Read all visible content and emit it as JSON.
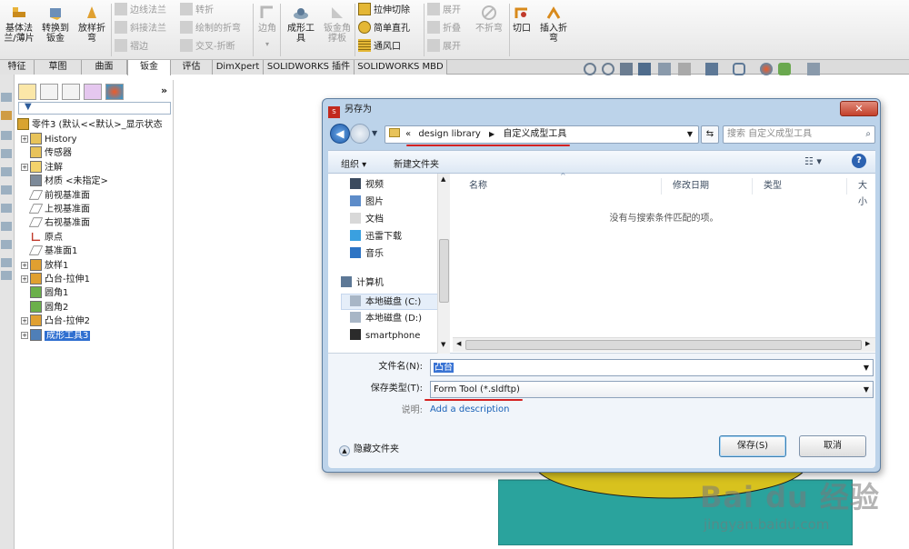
{
  "ribbon": {
    "big_buttons": [
      {
        "label": "基体法\n兰/薄片"
      },
      {
        "label": "转换到\n钣金"
      },
      {
        "label": "放样折\n弯"
      }
    ],
    "small_col1": [
      "边线法兰",
      "斜接法兰",
      "褶边"
    ],
    "small_col2": [
      "转折",
      "绘制的折弯",
      "交叉-折断"
    ],
    "corner_label": "边角",
    "forming_tool_label": "成形工\n具",
    "sheet_metal_gusset_label": "钣金角\n撑板",
    "small_col3": [
      "拉伸切除",
      "简单直孔",
      "通风口"
    ],
    "small_col4": [
      "展开",
      "折叠",
      "展开"
    ],
    "no_bend_label": "不折弯",
    "rip_label": "切口",
    "insert_bends_label": "插入折\n弯"
  },
  "tabs": [
    {
      "label": "特征",
      "active": false
    },
    {
      "label": "草图",
      "active": false
    },
    {
      "label": "曲面",
      "active": false
    },
    {
      "label": "钣金",
      "active": true
    },
    {
      "label": "评估",
      "active": false
    },
    {
      "label": "DimXpert",
      "active": false
    },
    {
      "label": "SOLIDWORKS 插件",
      "active": false
    },
    {
      "label": "SOLIDWORKS MBD",
      "active": false
    }
  ],
  "tree": {
    "root": "零件3  (默认<<默认>_显示状态",
    "items": [
      {
        "label": "History",
        "icon": "history-icon",
        "expandable": true
      },
      {
        "label": "传感器",
        "icon": "sensor-icon",
        "expandable": false
      },
      {
        "label": "注解",
        "icon": "annotation-icon",
        "expandable": true
      },
      {
        "label": "材质 <未指定>",
        "icon": "material-icon",
        "expandable": false
      },
      {
        "label": "前视基准面",
        "icon": "plane-icon",
        "expandable": false
      },
      {
        "label": "上视基准面",
        "icon": "plane-icon",
        "expandable": false
      },
      {
        "label": "右视基准面",
        "icon": "plane-icon",
        "expandable": false
      },
      {
        "label": "原点",
        "icon": "origin-icon",
        "expandable": false
      },
      {
        "label": "基准面1",
        "icon": "plane-icon",
        "expandable": false
      },
      {
        "label": "放样1",
        "icon": "loft-icon",
        "expandable": true
      },
      {
        "label": "凸台-拉伸1",
        "icon": "extrude-icon",
        "expandable": true
      },
      {
        "label": "圆角1",
        "icon": "fillet-icon",
        "expandable": false
      },
      {
        "label": "圆角2",
        "icon": "fillet-icon",
        "expandable": false
      },
      {
        "label": "凸台-拉伸2",
        "icon": "extrude-icon",
        "expandable": true
      },
      {
        "label": "成形工具3",
        "icon": "forming-tool-icon",
        "expandable": true,
        "selected": true
      }
    ]
  },
  "dialog": {
    "title": "另存为",
    "close_glyph": "✕",
    "path_prefix": "«",
    "path": [
      "design library",
      "自定义成型工具"
    ],
    "search_placeholder": "搜索 自定义成型工具",
    "organize_label": "组织 ▾",
    "new_folder_label": "新建文件夹",
    "nav_items": [
      {
        "label": "视频",
        "icon": "video-icon"
      },
      {
        "label": "图片",
        "icon": "picture-icon"
      },
      {
        "label": "文档",
        "icon": "document-icon"
      },
      {
        "label": "迅雷下载",
        "icon": "download-icon"
      },
      {
        "label": "音乐",
        "icon": "music-icon"
      },
      {
        "label": "计算机",
        "icon": "computer-icon"
      },
      {
        "label": "本地磁盘 (C:)",
        "icon": "drive-icon"
      },
      {
        "label": "本地磁盘 (D:)",
        "icon": "drive-icon"
      },
      {
        "label": "smartphone",
        "icon": "phone-icon"
      }
    ],
    "columns": [
      "名称",
      "修改日期",
      "类型",
      "大小"
    ],
    "empty_message": "没有与搜索条件匹配的项。",
    "filename_label": "文件名(N):",
    "filename_value": "凸台",
    "filetype_label": "保存类型(T):",
    "filetype_value": "Form Tool (*.sldftp)",
    "desc_label": "说明:",
    "desc_link": "Add a description",
    "hide_folders_label": "隐藏文件夹",
    "save_label": "保存(S)",
    "cancel_label": "取消"
  },
  "watermark": {
    "brand": "Bai du 经验",
    "url": "jingyan.baidu.com"
  },
  "colors": {
    "selection": "#2f6fd0",
    "link": "#1a62b8",
    "annotation": "#d42121",
    "model_teal": "#2aa39d"
  }
}
